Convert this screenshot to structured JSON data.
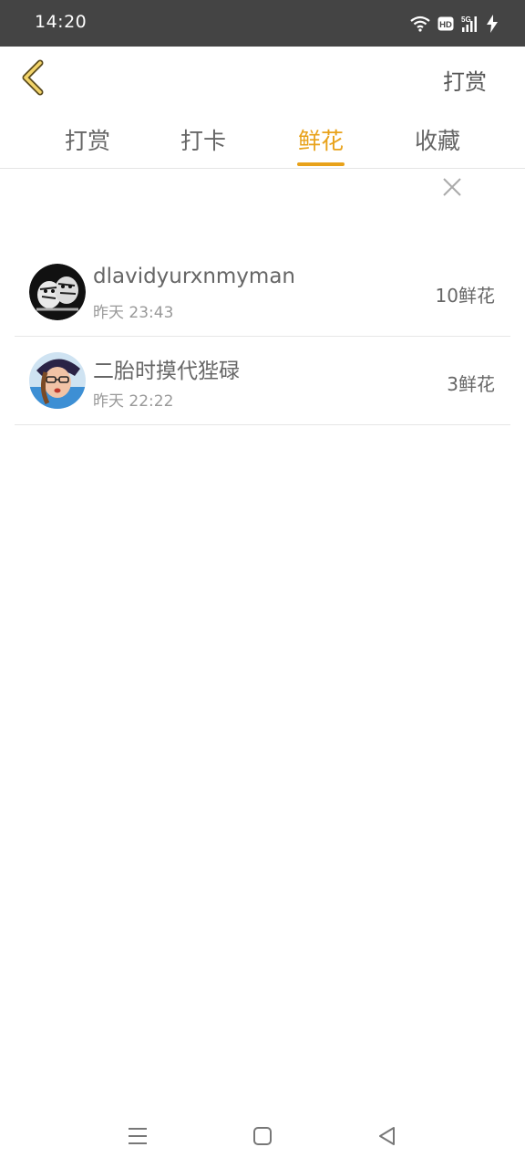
{
  "status_bar": {
    "time": "14:20",
    "icons": [
      "wifi-icon",
      "hd-icon",
      "5g-signal-icon",
      "charging-icon"
    ],
    "hd_label": "HD",
    "network_label": "5G"
  },
  "header": {
    "back_icon": "chevron-left-icon",
    "action_label": "打赏"
  },
  "tabs": [
    {
      "label": "打赏",
      "active": false
    },
    {
      "label": "打卡",
      "active": false
    },
    {
      "label": "鲜花",
      "active": true
    },
    {
      "label": "收藏",
      "active": false
    }
  ],
  "close_icon": "close-icon",
  "list": [
    {
      "name": "dlavidyurxnmyman",
      "time": "昨天 23:43",
      "count": "10鲜花",
      "avatar": "tiger-sketch-avatar"
    },
    {
      "name": "二胎时摸代狴碌",
      "time": "昨天 22:22",
      "count": "3鲜花",
      "avatar": "girl-photo-avatar"
    }
  ],
  "colors": {
    "accent": "#e8a21a",
    "status_bar": "#444444",
    "text": "#666666",
    "subtext": "#999999"
  },
  "nav_bar": {
    "icons": [
      "menu-icon",
      "home-icon",
      "back-icon"
    ]
  }
}
